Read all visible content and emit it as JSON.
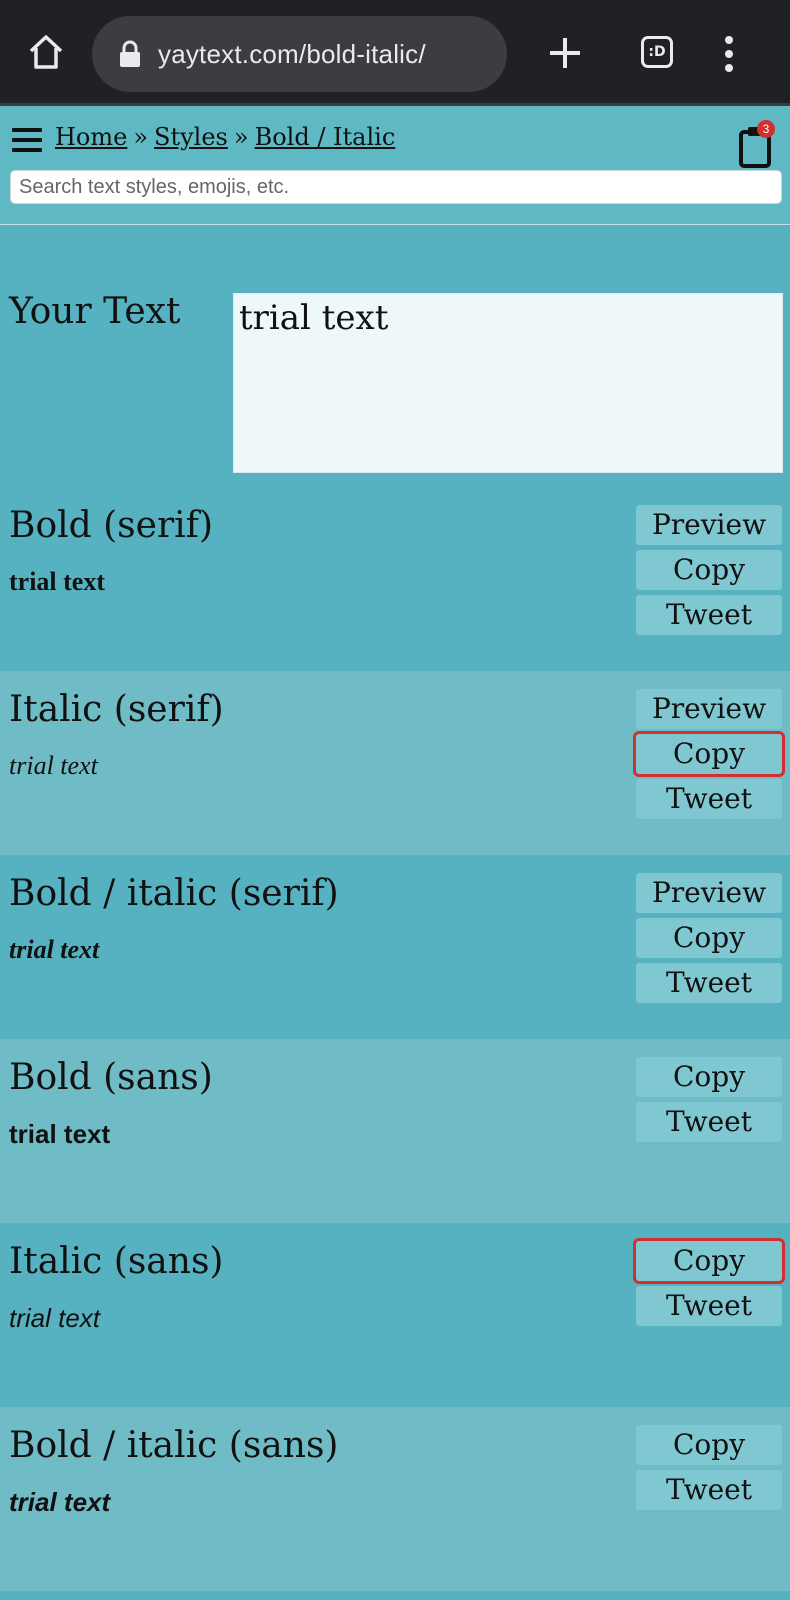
{
  "browser": {
    "url": "yaytext.com/bold-italic/",
    "tabs_label": ":D"
  },
  "header": {
    "breadcrumbs": [
      "Home",
      "Styles",
      "Bold / Italic"
    ],
    "separator": "»",
    "badge_count": "3",
    "search_placeholder": "Search text styles, emojis, etc."
  },
  "input": {
    "label": "Your Text",
    "value": "trial text"
  },
  "styles": [
    {
      "name": "Bold (serif)",
      "sample": "trial text",
      "preview": "Preview",
      "copy": "Copy",
      "tweet": "Tweet"
    },
    {
      "name": "Italic (serif)",
      "sample": "trial text",
      "preview": "Preview",
      "copy": "Copy",
      "tweet": "Tweet"
    },
    {
      "name": "Bold / italic (serif)",
      "sample": "trial text",
      "preview": "Preview",
      "copy": "Copy",
      "tweet": "Tweet"
    },
    {
      "name": "Bold (sans)",
      "sample": "trial text",
      "copy": "Copy",
      "tweet": "Tweet"
    },
    {
      "name": "Italic (sans)",
      "sample": "trial text",
      "copy": "Copy",
      "tweet": "Tweet"
    },
    {
      "name": "Bold / italic (sans)",
      "sample": "trial text",
      "copy": "Copy",
      "tweet": "Tweet"
    }
  ],
  "colors": {
    "highlight": "#d32f2f",
    "row_light": "#6fbcc7",
    "row_dark": "#56b2c1"
  },
  "icons": [
    "home-icon",
    "lock-icon",
    "plus-icon",
    "tab-switcher-icon",
    "more-vert-icon",
    "hamburger-menu-icon",
    "clipboard-icon"
  ]
}
